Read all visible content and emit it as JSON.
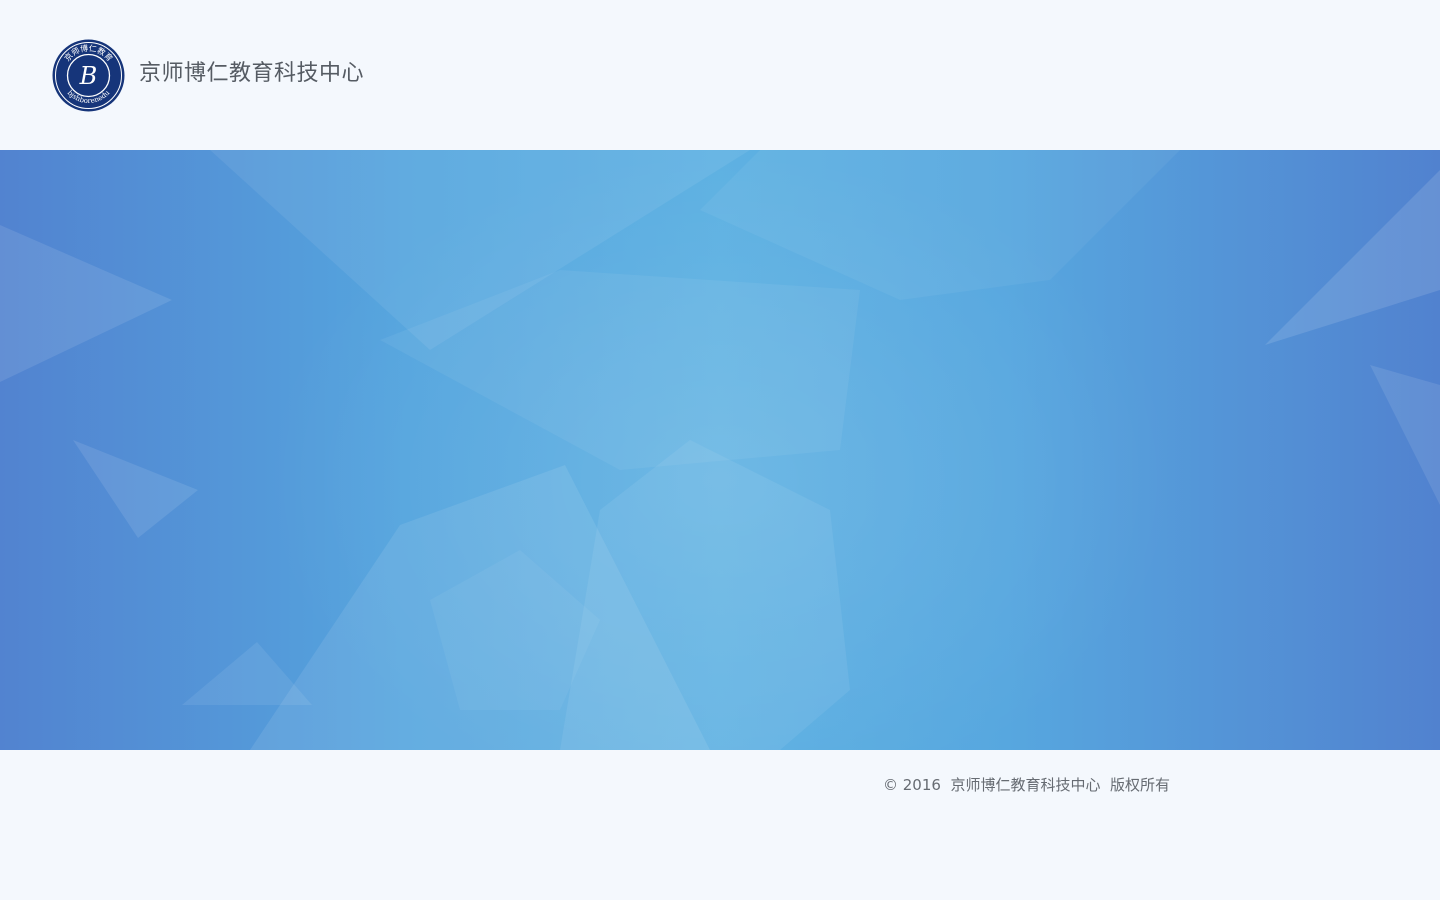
{
  "header": {
    "brand_name": "京师博仁教育科技中心",
    "logo_icon": "bjbr-seal-logo-icon",
    "logo_text_top": "京师博仁教育",
    "logo_text_bottom": "bjshborenedu",
    "logo_letter": "B"
  },
  "banner": {
    "description_icon": "abstract-geometric-background-icon"
  },
  "footer": {
    "copyright": "© 2016  京师博仁教育科技中心  版权所有"
  },
  "colors": {
    "page_background": "#f4f8fd",
    "banner_blue_edge": "#5283d0",
    "banner_blue_center": "#5eb1e2",
    "brand_text": "#555b63",
    "logo_navy": "#16357a"
  }
}
